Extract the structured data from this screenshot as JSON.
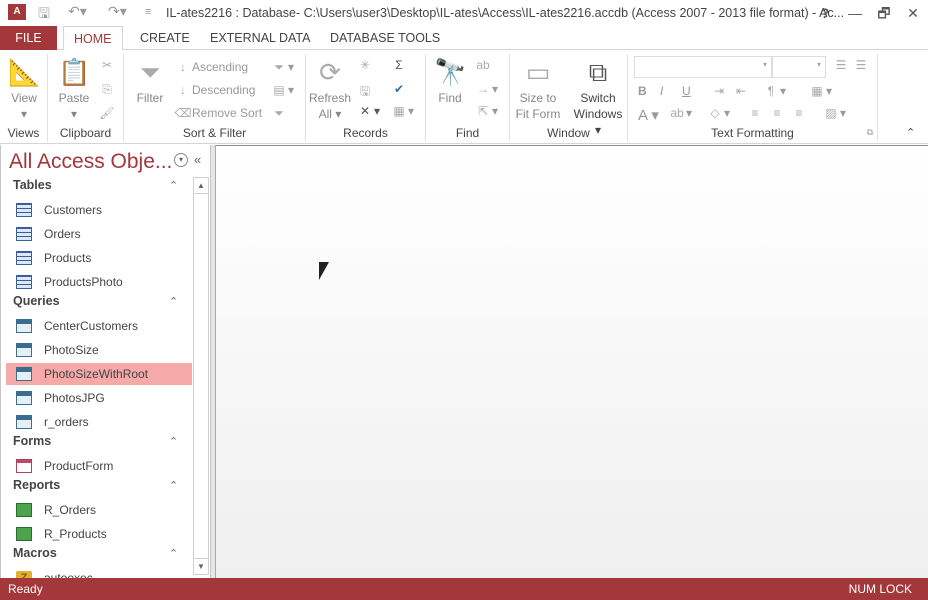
{
  "titlebar": {
    "app_icon": "A",
    "title": "IL-ates2216 : Database- C:\\Users\\user3\\Desktop\\IL-ates\\Access\\IL-ates2216.accdb (Access 2007 - 2013 file format) - Ac...",
    "help": "?",
    "minimize": "—",
    "restore": "🗗",
    "close": "✕"
  },
  "tabs": [
    "FILE",
    "HOME",
    "CREATE",
    "EXTERNAL DATA",
    "DATABASE TOOLS"
  ],
  "ribbon": {
    "views": {
      "label": "Views",
      "view": "View"
    },
    "clipboard": {
      "label": "Clipboard",
      "paste": "Paste"
    },
    "sort_filter": {
      "label": "Sort & Filter",
      "filter": "Filter",
      "ascending": "Ascending",
      "descending": "Descending",
      "remove_sort": "Remove Sort"
    },
    "records": {
      "label": "Records",
      "refresh": "Refresh",
      "refresh2": "All"
    },
    "find": {
      "label": "Find",
      "find": "Find"
    },
    "window": {
      "label": "Window",
      "size1": "Size to",
      "size2": "Fit Form",
      "switch1": "Switch",
      "switch2": "Windows"
    },
    "text_formatting": {
      "label": "Text Formatting",
      "bold": "B",
      "italic": "I",
      "underline": "U",
      "font_color": "A"
    }
  },
  "nav": {
    "title": "All Access Obje...",
    "categories": [
      {
        "name": "Tables",
        "items": [
          "Customers",
          "Orders",
          "Products",
          "ProductsPhoto"
        ]
      },
      {
        "name": "Queries",
        "items": [
          "CenterCustomers",
          "PhotoSize",
          "PhotoSizeWithRoot",
          "PhotosJPG",
          "r_orders"
        ]
      },
      {
        "name": "Forms",
        "items": [
          "ProductForm"
        ]
      },
      {
        "name": "Reports",
        "items": [
          "R_Orders",
          "R_Products"
        ]
      },
      {
        "name": "Macros",
        "items": [
          "autoexec"
        ]
      }
    ],
    "selected": "PhotoSizeWithRoot"
  },
  "status": {
    "left": "Ready",
    "right": "NUM LOCK"
  },
  "colors": {
    "accent": "#a4373a",
    "selected": "#f5a9a9"
  }
}
